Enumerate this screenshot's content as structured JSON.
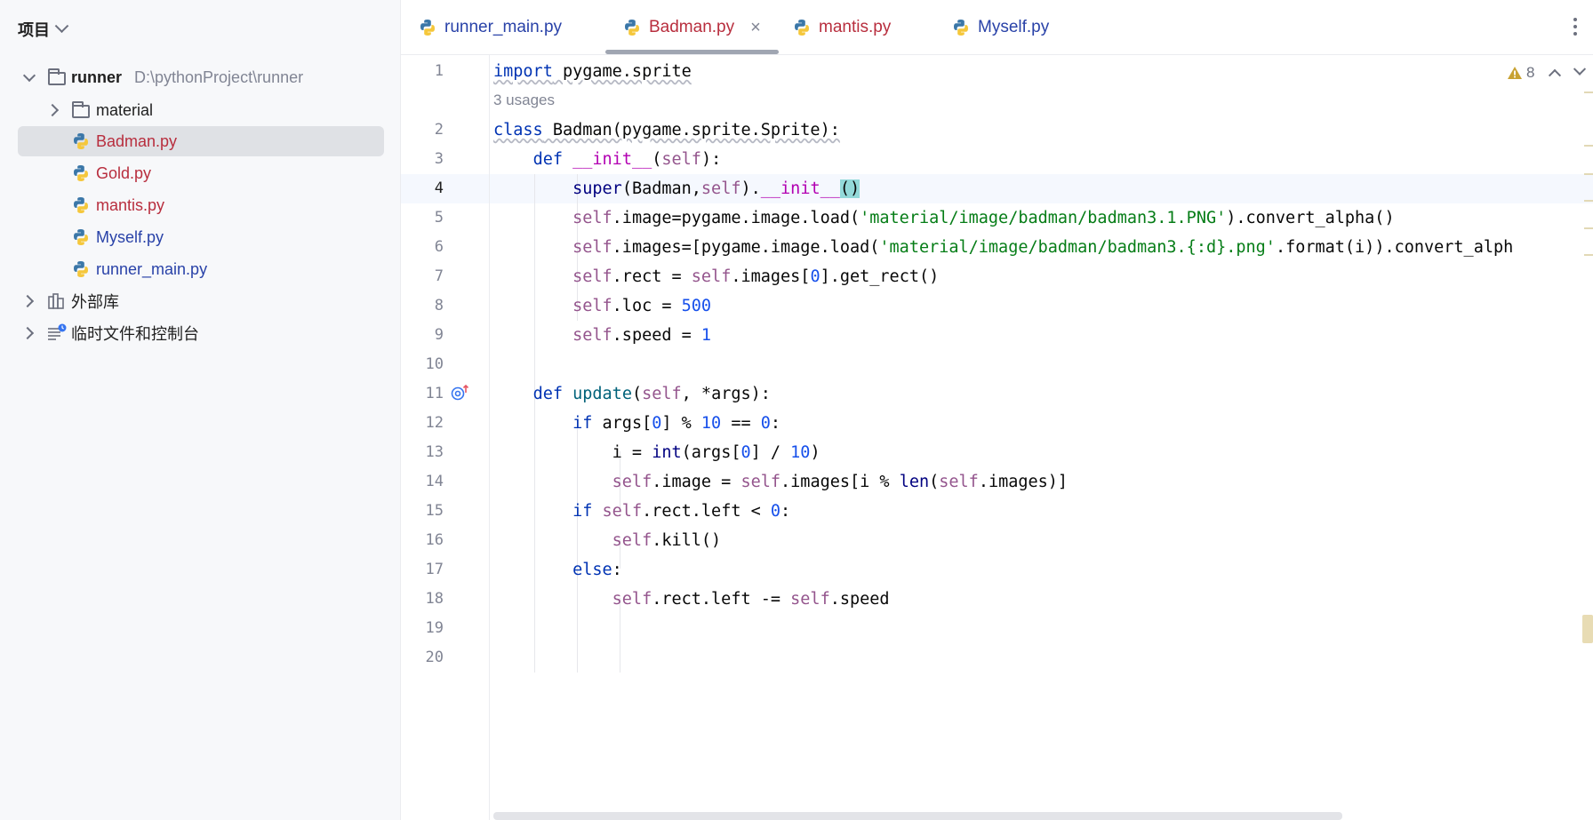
{
  "sidebar": {
    "title": "项目",
    "root": {
      "name": "runner",
      "path": "D:\\pythonProject\\runner"
    },
    "items": [
      {
        "name": "material",
        "type": "folder"
      },
      {
        "name": "Badman.py",
        "type": "python",
        "color": "#b82e3e",
        "selected": true
      },
      {
        "name": "Gold.py",
        "type": "python",
        "color": "#b82e3e"
      },
      {
        "name": "mantis.py",
        "type": "python",
        "color": "#b82e3e"
      },
      {
        "name": "Myself.py",
        "type": "python",
        "color": "#2942a8"
      },
      {
        "name": "runner_main.py",
        "type": "python",
        "color": "#2942a8"
      }
    ],
    "external_libs": "外部库",
    "scratches": "临时文件和控制台"
  },
  "tabs": [
    {
      "label": "runner_main.py",
      "color": "#2942a8"
    },
    {
      "label": "Badman.py",
      "color": "#b82e3e",
      "active": true,
      "close": "×"
    },
    {
      "label": "mantis.py",
      "color": "#b82e3e"
    },
    {
      "label": "Myself.py",
      "color": "#2942a8"
    }
  ],
  "editor": {
    "warning_count": "8",
    "usages_hint": "3 usages",
    "current_line": 4,
    "line_numbers": [
      "1",
      "2",
      "3",
      "4",
      "5",
      "6",
      "7",
      "8",
      "9",
      "10",
      "11",
      "12",
      "13",
      "14",
      "15",
      "16",
      "17",
      "18",
      "19",
      "20"
    ],
    "code": {
      "l1_kw": "import",
      "l1_rest": " pygame.sprite",
      "l2_kw": "class",
      "l2_rest": " Badman(pygame.sprite.Sprite):",
      "l3_kw": "def",
      "l3_fn": "__init__",
      "l3_self": "self",
      "l4_super": "super",
      "l4_cls": "(Badman,",
      "l4_self": "self",
      "l4_dunder": "__init__",
      "l4_parens": "()",
      "l5_self": "self",
      "l5_mid": ".image=pygame.image.load(",
      "l5_str": "'material/image/badman/badman3.1.PNG'",
      "l5_end": ").convert_alpha()",
      "l6_self": "self",
      "l6_mid": ".images=[pygame.image.load(",
      "l6_str": "'material/image/badman/badman3.{:d}.png'",
      "l6_end": ".format(i)).convert_alph",
      "l7_self": "self",
      "l7_mid": ".rect = ",
      "l7_self2": "self",
      "l7_mid2": ".images[",
      "l7_num": "0",
      "l7_end": "].get_rect()",
      "l8_self": "self",
      "l8_mid": ".loc = ",
      "l8_num": "500",
      "l9_self": "self",
      "l9_mid": ".speed = ",
      "l9_num": "1",
      "l11_kw": "def",
      "l11_fn": "update",
      "l11_self": "self",
      "l11_end": ", *args):",
      "l12_kw": "if",
      "l12_a": " args[",
      "l12_n0": "0",
      "l12_b": "] % ",
      "l12_n1": "10",
      "l12_c": " == ",
      "l12_n2": "0",
      "l12_d": ":",
      "l13_a": "i = ",
      "l13_int": "int",
      "l13_b": "(args[",
      "l13_n0": "0",
      "l13_c": "] / ",
      "l13_n1": "10",
      "l13_d": ")",
      "l14_self": "self",
      "l14_a": ".image = ",
      "l14_self2": "self",
      "l14_b": ".images[i % ",
      "l14_len": "len",
      "l14_c": "(",
      "l14_self3": "self",
      "l14_d": ".images)]",
      "l15_kw": "if",
      "l15_self": "self",
      "l15_a": ".rect.left < ",
      "l15_n": "0",
      "l15_b": ":",
      "l16_self": "self",
      "l16_a": ".kill()",
      "l17_kw": "else",
      "l17_a": ":",
      "l18_self": "self",
      "l18_a": ".rect.left -= ",
      "l18_self2": "self",
      "l18_b": ".speed"
    }
  },
  "colors": {
    "accent": "#3574f0",
    "keyword": "#0033b3",
    "self": "#94558d",
    "string": "#067d17",
    "number": "#1750eb"
  }
}
